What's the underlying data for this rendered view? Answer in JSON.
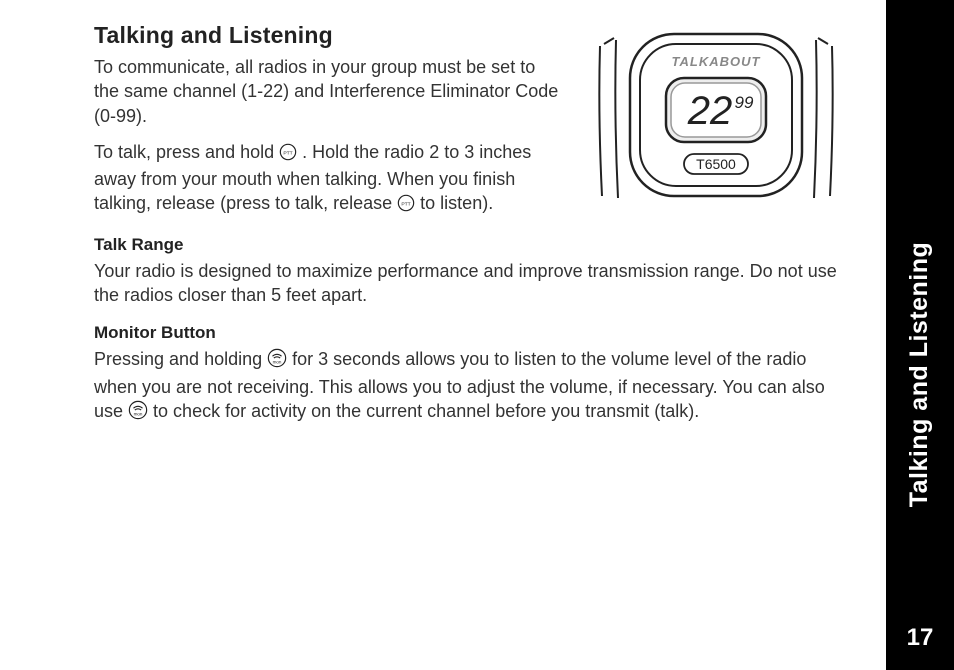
{
  "sidebar": {
    "section_title": "Talking and Listening",
    "page_number": "17"
  },
  "heading": "Talking and Listening",
  "paragraph1": "To communicate, all radios in your group must be set to the same channel (1-22) and Interference Eliminator Code (0-99).",
  "paragraph2a": "To talk, press and hold ",
  "paragraph2b": " . Hold the radio 2 to 3 inches away from your mouth when talking. When you finish talking, release (press to talk, release ",
  "paragraph2c": " to listen).",
  "subhead1": "Talk Range",
  "paragraph3": "Your radio is designed to maximize performance and improve transmission range. Do not use the radios closer than 5 feet apart.",
  "subhead2": "Monitor Button",
  "paragraph4a": "Pressing and holding ",
  "paragraph4b": " for 3 seconds allows you to listen to the volume level of the radio when you are not receiving. This allows you to adjust the volume, if necessary. You can also use ",
  "paragraph4c": " to check for activity on the current channel before you transmit (talk).",
  "device": {
    "brand": "TALKABOUT",
    "display_main": "22",
    "display_sub": "99",
    "model": "T6500"
  },
  "icons": {
    "ptt_label": "PTT",
    "monitor_label": "mon"
  }
}
